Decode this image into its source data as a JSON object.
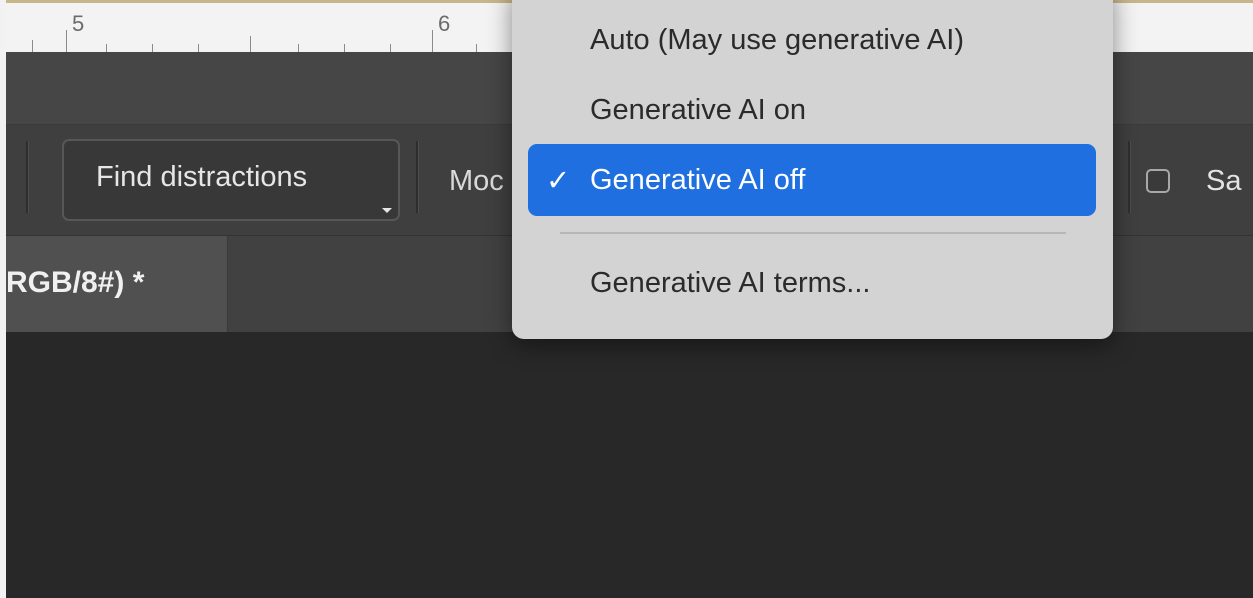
{
  "ruler": {
    "mark_5": "5",
    "mark_6": "6"
  },
  "options_bar": {
    "find_distractions_label": "Find distractions",
    "mode_label_partial": "Moc",
    "checkbox_checked": false,
    "checkbox_label_partial": "Sa"
  },
  "document_tab": {
    "title_partial": "RGB/8#) *"
  },
  "mode_menu": {
    "items": [
      {
        "label": "Auto (May use generative AI)",
        "selected": false
      },
      {
        "label": "Generative AI on",
        "selected": false
      },
      {
        "label": "Generative AI off",
        "selected": true
      },
      {
        "label": "Generative AI terms...",
        "selected": false
      }
    ],
    "check_icon": "checkmark-icon",
    "selected_color": "#1f6fe0"
  },
  "colors": {
    "canvas": "#282828",
    "options_bar": "#3f3f3f",
    "menu_background": "#d3d3d3"
  }
}
